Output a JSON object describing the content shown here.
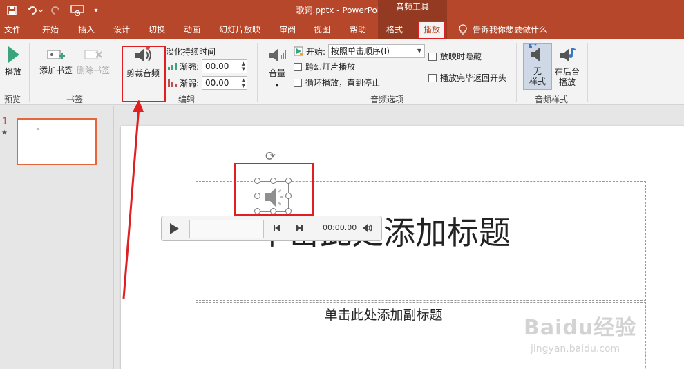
{
  "title_bar": {
    "document": "歌词.pptx - PowerPoint",
    "context_tools": "音频工具"
  },
  "tabs": [
    {
      "label": "文件"
    },
    {
      "label": "开始"
    },
    {
      "label": "插入"
    },
    {
      "label": "设计"
    },
    {
      "label": "切换"
    },
    {
      "label": "动画"
    },
    {
      "label": "幻灯片放映"
    },
    {
      "label": "审阅"
    },
    {
      "label": "视图"
    },
    {
      "label": "帮助"
    },
    {
      "label": "格式"
    },
    {
      "label": "播放",
      "active": true
    }
  ],
  "tell_me": "告诉我你想要做什么",
  "ribbon": {
    "preview": {
      "play_label": "播放",
      "group": "预览"
    },
    "bookmarks": {
      "add_label": "添加书签",
      "remove_label": "删除书签",
      "group": "书签"
    },
    "editing": {
      "trim_label": "剪裁音频",
      "fade_title": "淡化持续时间",
      "fade_in_label": "渐强:",
      "fade_in_value": "00.00",
      "fade_out_label": "渐弱:",
      "fade_out_value": "00.00",
      "group": "编辑"
    },
    "audio_options": {
      "volume_label": "音量",
      "start_label": "开始:",
      "start_value": "按照单击顺序(I)",
      "cross_slides": "跨幻灯片播放",
      "loop": "循环播放，直到停止",
      "hide_during_show": "放映时隐藏",
      "rewind_after": "播放完毕返回开头",
      "group": "音频选项"
    },
    "audio_styles": {
      "no_style_line1": "无",
      "no_style_line2": "样式",
      "background_line1": "在后台",
      "background_line2": "播放",
      "group": "音频样式"
    }
  },
  "thumbnails": {
    "number": "1",
    "star": "★"
  },
  "slide": {
    "title_placeholder": "单击此处添加标题",
    "subtitle_placeholder": "单击此处添加副标题"
  },
  "player": {
    "time": "00:00.00"
  },
  "watermark": {
    "brand": "Baidu经验",
    "url": "jingyan.baidu.com"
  },
  "colors": {
    "accent": "#b7472a",
    "context": "#943a22",
    "highlight": "#e02020"
  },
  "icons": [
    "save-icon",
    "undo-icon",
    "redo-icon",
    "slideshow-icon",
    "customize-icon",
    "lightbulb-icon",
    "play-icon",
    "speaker-icon"
  ]
}
